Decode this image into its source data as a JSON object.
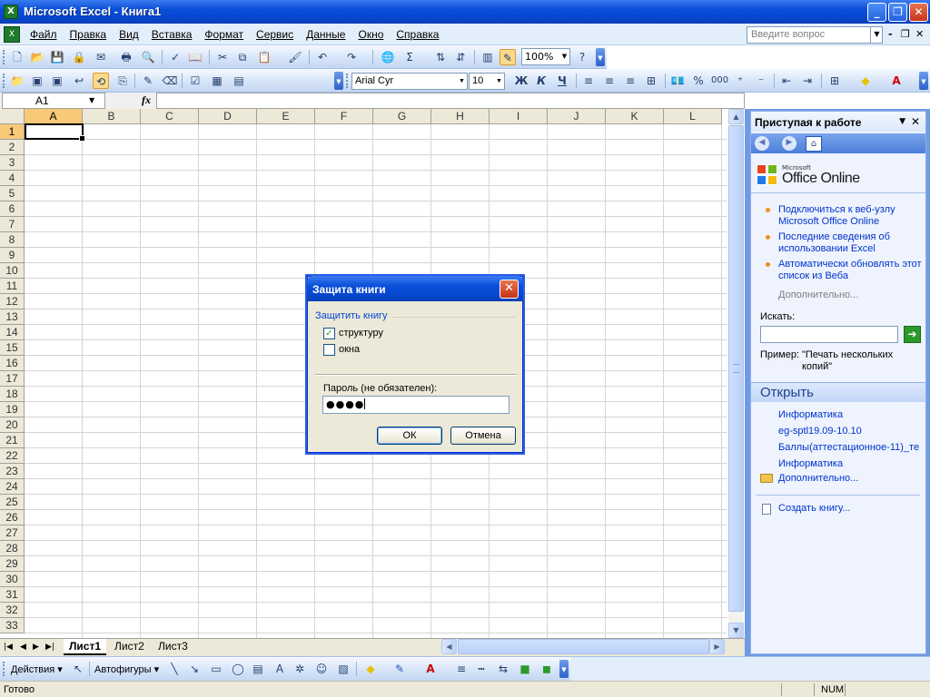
{
  "window": {
    "title": "Microsoft Excel - Книга1",
    "app_icon": "excel-icon"
  },
  "menu": {
    "items": [
      "Файл",
      "Правка",
      "Вид",
      "Вставка",
      "Формат",
      "Сервис",
      "Данные",
      "Окно",
      "Справка"
    ],
    "help_placeholder": "Введите вопрос"
  },
  "toolbar": {
    "zoom": "100%"
  },
  "format": {
    "font": "Arial Cyr",
    "size": "10",
    "bold": "Ж",
    "italic": "К",
    "underline": "Ч",
    "percent": "%",
    "thousands": "000"
  },
  "formula": {
    "name_box": "A1",
    "fx": "fx",
    "content": ""
  },
  "grid": {
    "columns": [
      "A",
      "B",
      "C",
      "D",
      "E",
      "F",
      "G",
      "H",
      "I",
      "J",
      "K",
      "L"
    ],
    "rows": [
      "1",
      "2",
      "3",
      "4",
      "5",
      "6",
      "7",
      "8",
      "9",
      "10",
      "11",
      "12",
      "13",
      "14",
      "15",
      "16",
      "17",
      "18",
      "19",
      "20",
      "21",
      "22",
      "23",
      "24",
      "25",
      "26",
      "27",
      "28",
      "29",
      "30",
      "31",
      "32",
      "33"
    ],
    "selected_cell": "A1"
  },
  "sheets": {
    "tabs": [
      "Лист1",
      "Лист2",
      "Лист3"
    ],
    "active": "Лист1"
  },
  "taskpane": {
    "title": "Приступая к работе",
    "logo_small": "Microsoft",
    "logo_big": "Office Online",
    "links": [
      "Подключиться к веб-узлу Microsoft Office Online",
      "Последние сведения об использовании Excel",
      "Автоматически обновлять этот список из Веба"
    ],
    "more": "Дополнительно...",
    "search_label": "Искать:",
    "example_label": "Пример:",
    "example_value": "\"Печать нескольких копий\"",
    "open_title": "Открыть",
    "files": [
      "Информатика",
      "eg-sptl19.09-10.10",
      "Баллы(аттестационное-11)_те",
      "Информатика"
    ],
    "open_more": "Дополнительно...",
    "create": "Создать книгу..."
  },
  "drawbar": {
    "actions": "Действия",
    "autoshapes": "Автофигуры"
  },
  "status": {
    "ready": "Готово",
    "num": "NUM"
  },
  "dialog": {
    "title": "Защита книги",
    "group_label": "Защитить книгу",
    "opt_structure": "структуру",
    "opt_structure_checked": true,
    "opt_windows": "окна",
    "opt_windows_checked": false,
    "password_label": "Пароль (не обязателен):",
    "password_value": "●●●●",
    "ok": "ОК",
    "cancel": "Отмена"
  },
  "colors": {
    "titlebar": "#0a4fd8",
    "accent_link": "#0033cc",
    "selection": "#f8c978"
  }
}
